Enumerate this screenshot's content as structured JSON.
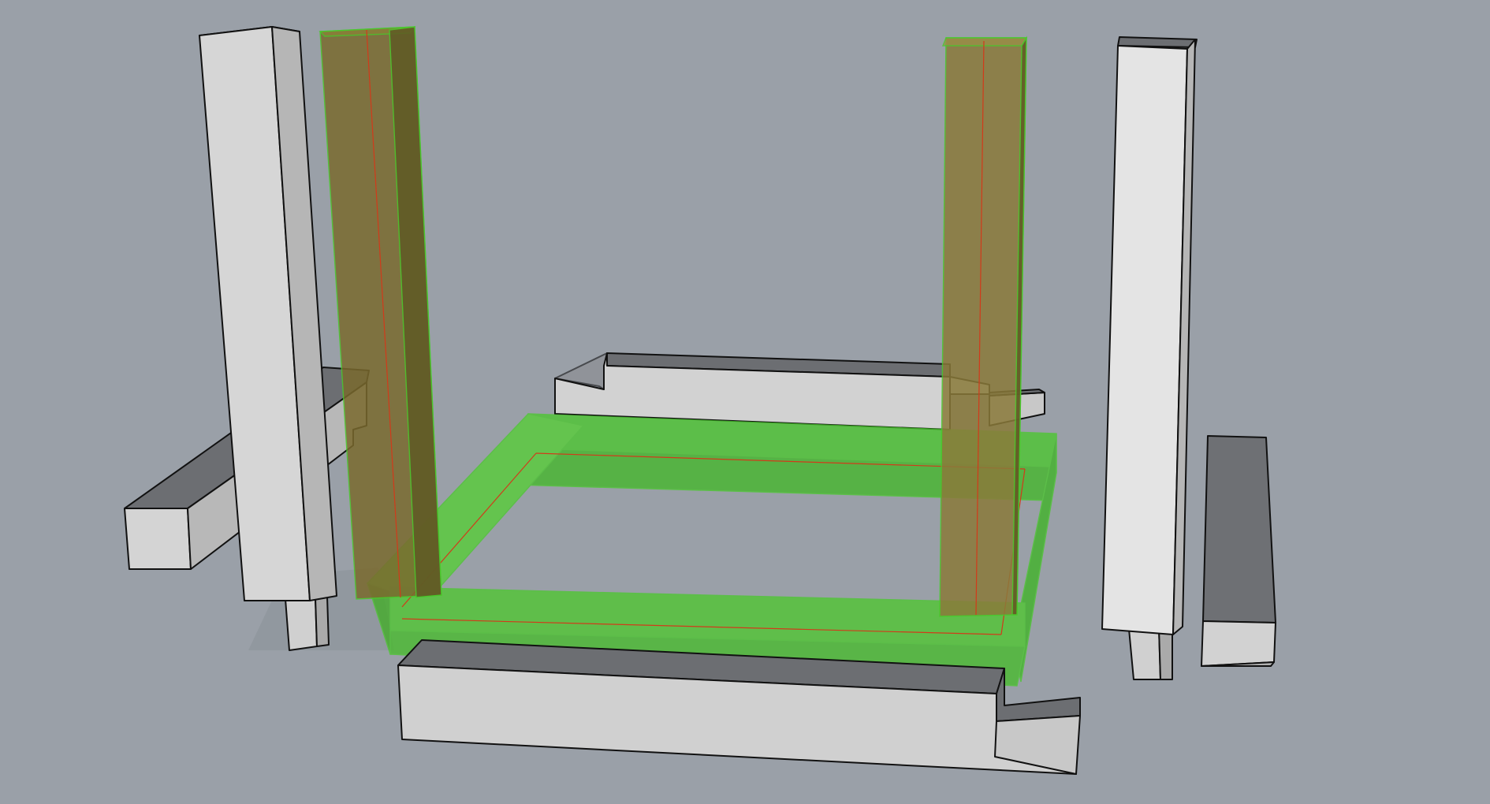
{
  "viewport": {
    "background_color": "#9aa0a8",
    "selection_color": "#44cc22",
    "selection_overlay_opacity": 0.55,
    "highlight_color": "#8a6a30",
    "construction_line_color": "#d23a1a"
  }
}
